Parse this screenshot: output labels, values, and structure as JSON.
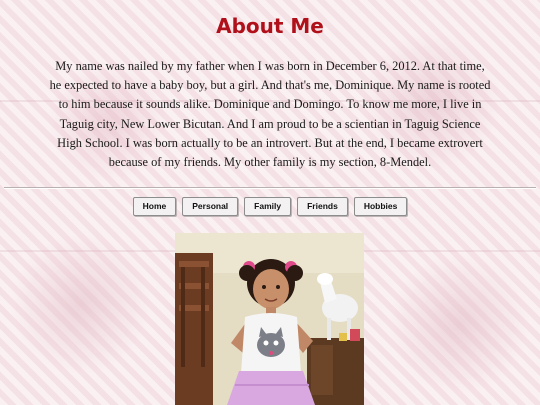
{
  "page": {
    "title": "About Me",
    "bio": "My name was nailed by my father when I was born in December 6, 2012. At that time, he expected to have a baby boy, but a girl. And that's me, Dominique. My name is rooted to him because it sounds alike. Dominique and Domingo. To know me more, I live in Taguig city, New Lower Bicutan. And I am proud to be a scientian in Taguig Science High School. I was born actually to be an introvert. But at the end, I became extrovert because of my friends. My other family is my section, 8-Mendel."
  },
  "nav": {
    "home_label": "Home",
    "personal_label": "Personal",
    "family_label": "Family",
    "friends_label": "Friends",
    "hobbies_label": "Hobbies"
  },
  "photo": {
    "alt": "Photo of a little girl in a white shirt with a cat print",
    "icon": "child-photo"
  },
  "colors": {
    "title": "#b0101a",
    "background": "#f7e9ec",
    "button_bg": "#f3f1f1"
  }
}
